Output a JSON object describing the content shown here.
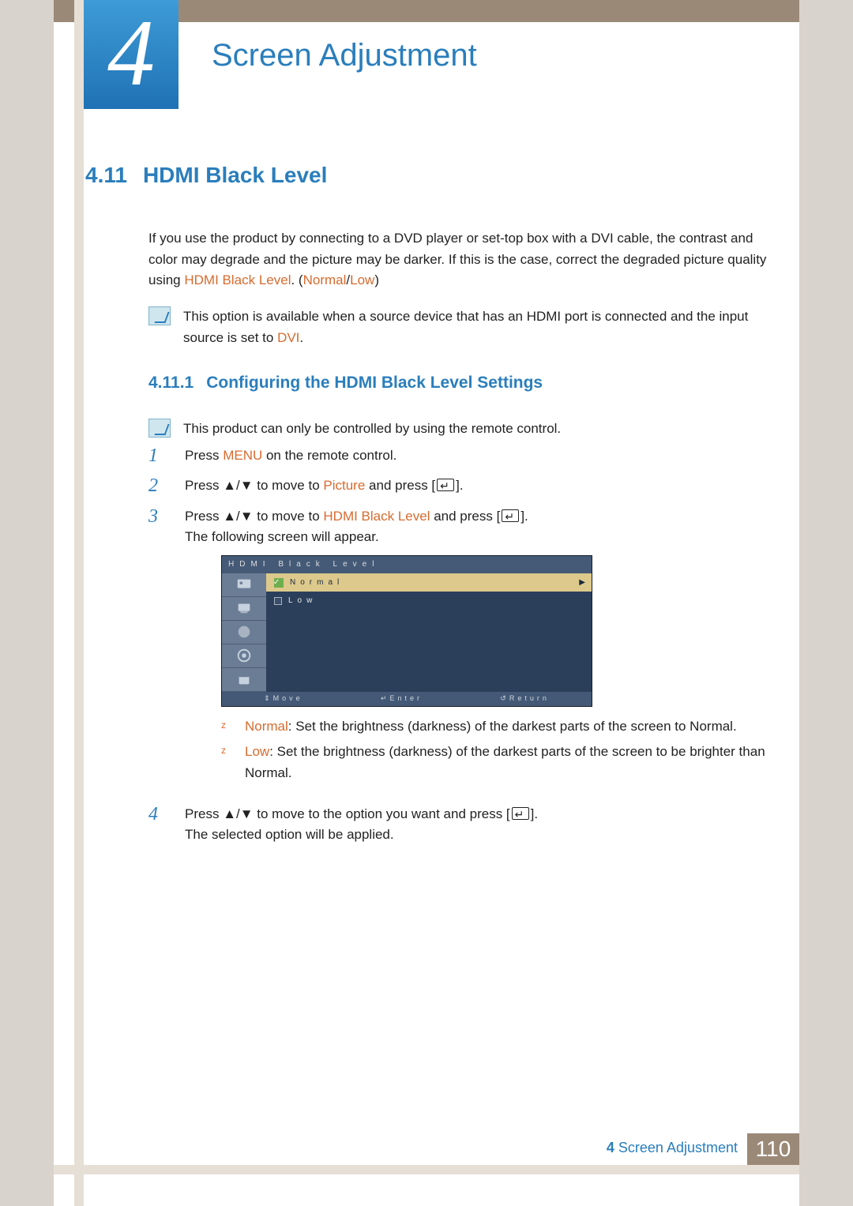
{
  "chapter": {
    "number": "4",
    "title": "Screen Adjustment"
  },
  "section": {
    "number": "4.11",
    "title": "HDMI Black Level"
  },
  "intro": {
    "p1a": "If you use the product by connecting to a DVD player or set-top box with a DVI cable, the contrast and color may degrade and the picture may be darker. If this is the case, correct the degraded picture quality using ",
    "hl1": "HDMI Black Level",
    "p1b": ". (",
    "hl2": "Normal",
    "p1c": "/",
    "hl3": "Low",
    "p1d": ")"
  },
  "note1": {
    "a": "This option is available when a source device that has an HDMI port is connected and the input source is set to ",
    "hl": "DVI",
    "b": "."
  },
  "subsection": {
    "number": "4.11.1",
    "title": "Configuring the HDMI Black Level Settings"
  },
  "note2": "This product can only be controlled by using the remote control.",
  "steps": {
    "s1": {
      "a": "Press ",
      "hl": "MENU",
      "b": " on the remote control."
    },
    "s2": {
      "a": "Press ",
      "arrows": "▲/▼",
      "b": " to move to ",
      "hl": "Picture",
      "c": " and press [",
      "d": "]."
    },
    "s3": {
      "a": "Press ",
      "arrows": "▲/▼",
      "b": " to move to ",
      "hl": "HDMI Black Level",
      "c": " and press [",
      "d": "].",
      "e": "The following screen will appear."
    },
    "s4": {
      "a": "Press ",
      "arrows": "▲/▼",
      "b": " to move to the option you want and press [",
      "c": "].",
      "d": "The selected option will be applied."
    }
  },
  "osd": {
    "title": "HDMI Black Level",
    "opt1": "Normal",
    "opt2": "Low",
    "f1": "Move",
    "f2": "Enter",
    "f3": "Return"
  },
  "bullets": {
    "b1": {
      "hl": "Normal",
      "t": ": Set the brightness (darkness) of the darkest parts of the screen to Normal."
    },
    "b2": {
      "hl": "Low",
      "t": ": Set the brightness (darkness) of the darkest parts of the screen to be brighter than Normal."
    }
  },
  "footer": {
    "label_prefix": "4",
    "label": "Screen Adjustment",
    "page": "110"
  }
}
